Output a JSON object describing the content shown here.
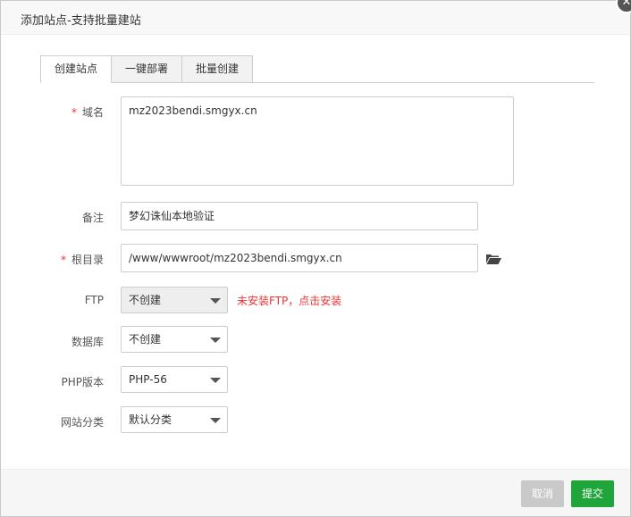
{
  "dialog": {
    "title": "添加站点-支持批量建站",
    "close_symbol": "✕"
  },
  "tabs": [
    {
      "label": "创建站点",
      "active": true
    },
    {
      "label": "一键部署",
      "active": false
    },
    {
      "label": "批量创建",
      "active": false
    }
  ],
  "form": {
    "required_mark": "*",
    "domain": {
      "label": "域名",
      "value": "mz2023bendi.smgyx.cn"
    },
    "remark": {
      "label": "备注",
      "value": "梦幻诛仙本地验证"
    },
    "root": {
      "label": "根目录",
      "value": "/www/wwwroot/mz2023bendi.smgyx.cn",
      "icon": "folder-open-icon"
    },
    "ftp": {
      "label": "FTP",
      "value": "不创建",
      "hint": "未安装FTP，点击安装"
    },
    "database": {
      "label": "数据库",
      "value": "不创建"
    },
    "php": {
      "label": "PHP版本",
      "value": "PHP-56"
    },
    "category": {
      "label": "网站分类",
      "value": "默认分类"
    }
  },
  "footer": {
    "cancel_label": "取消",
    "submit_label": "提交"
  },
  "colors": {
    "accent": "#20a53a",
    "danger": "#ee3333",
    "cancel_disabled": "#c9c9c9"
  }
}
